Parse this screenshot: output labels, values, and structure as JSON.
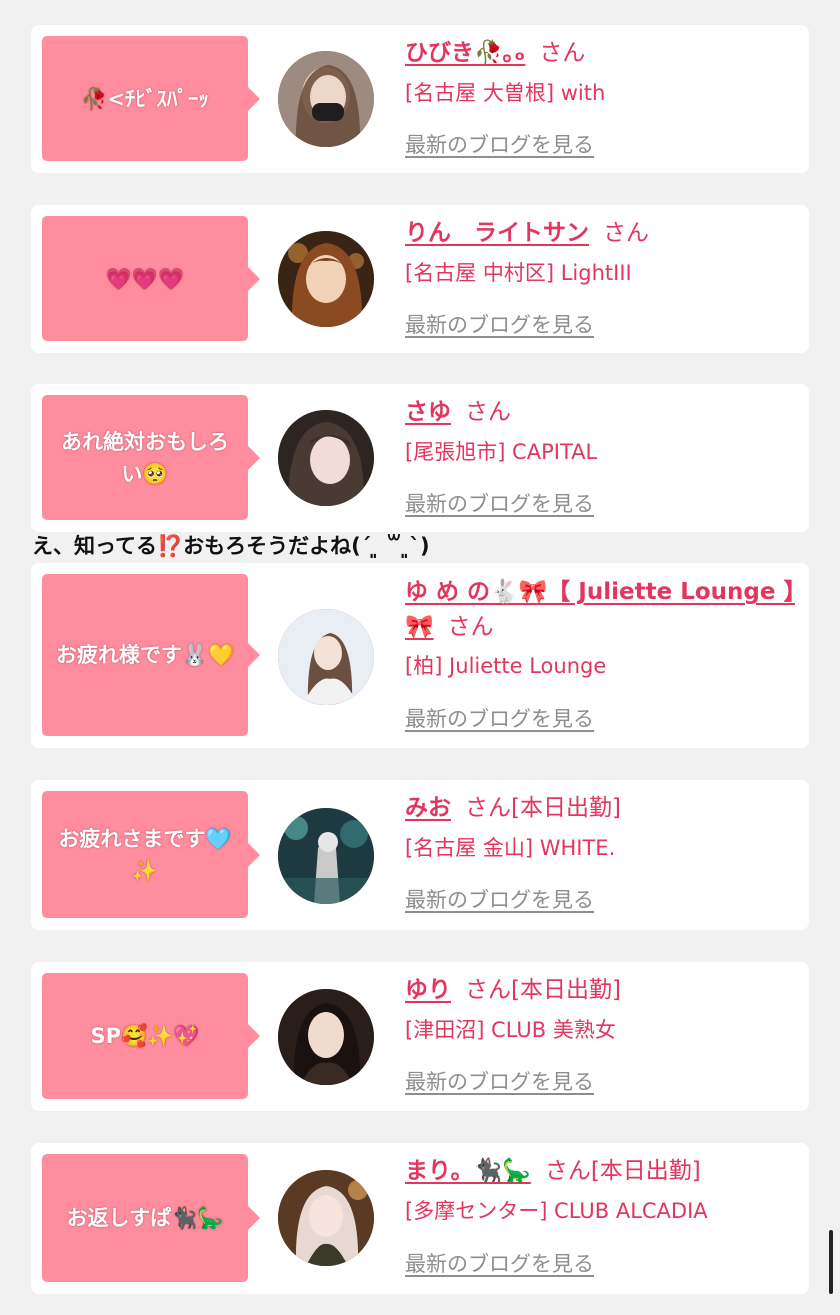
{
  "overlay_comment": "え、知ってる⁉️おもろそうだよね(ˊ ͈ ꒳ ͈ˋ)",
  "cards": [
    {
      "bubble": "🥀<ﾁﾋﾞｽﾊﾟｰｯ",
      "name": "ひびき🥀｡ₒ",
      "suffix": "さん",
      "tag": "",
      "shop": "[名古屋 大曽根] with",
      "blog_link": "最新のブログを見る"
    },
    {
      "bubble": "💗💗💗",
      "name": "りん　ライトサン",
      "suffix": "さん",
      "tag": "",
      "shop": "[名古屋 中村区] LightIII",
      "blog_link": "最新のブログを見る"
    },
    {
      "bubble": "あれ絶対おもしろい🥺",
      "name": "さゆ",
      "suffix": "さん",
      "tag": "",
      "shop": "[尾張旭市] CAPITAL",
      "blog_link": "最新のブログを見る"
    },
    {
      "bubble": "お疲れ様です🐰💛",
      "name": "ゆ め の🐇🎀【 Juliette Lounge 】🎀",
      "suffix": "さん",
      "tag": "",
      "shop": "[柏] Juliette Lounge",
      "blog_link": "最新のブログを見る"
    },
    {
      "bubble": "お疲れさまです🩵✨",
      "name": "みお",
      "suffix": "さん",
      "tag": "[本日出勤]",
      "shop": "[名古屋 金山] WHITE.",
      "blog_link": "最新のブログを見る"
    },
    {
      "bubble": "SP🥰✨💖",
      "name": "ゆり",
      "suffix": "さん",
      "tag": "[本日出勤]",
      "shop": "[津田沼] CLUB 美熟女",
      "blog_link": "最新のブログを見る"
    },
    {
      "bubble": "お返しすぱ🐈‍⬛🦕",
      "name": "まり。🐈‍⬛🦕",
      "suffix": "さん",
      "tag": "[本日出勤]",
      "shop": "[多摩センター] CLUB ALCADIA",
      "blog_link": "最新のブログを見る"
    }
  ]
}
